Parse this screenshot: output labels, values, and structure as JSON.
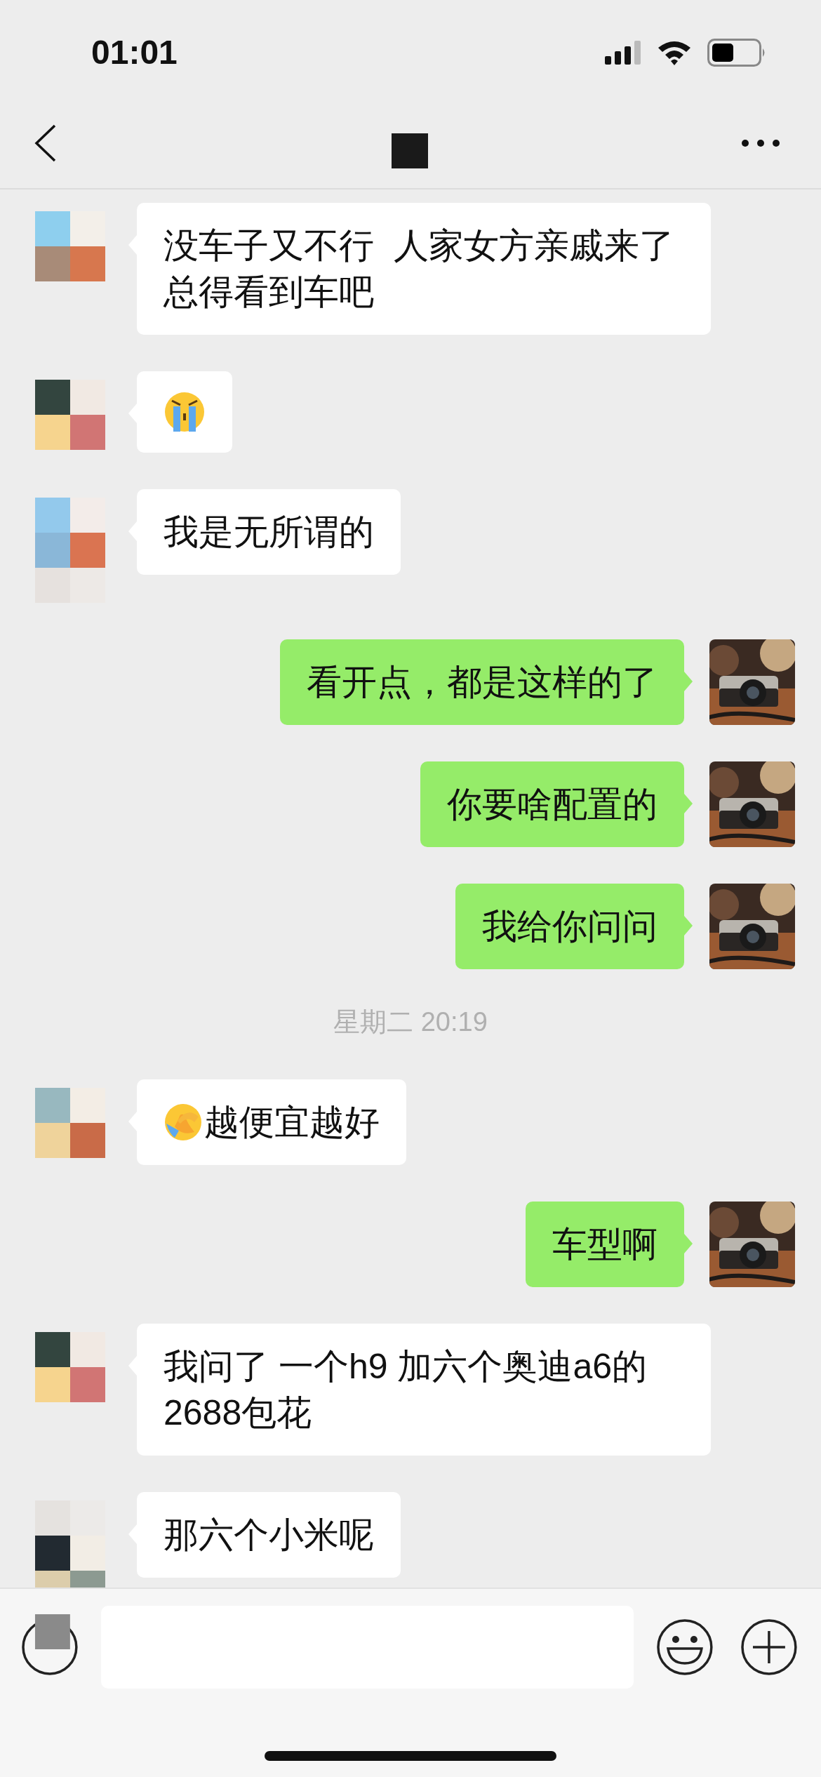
{
  "status_bar": {
    "time": "01:01"
  },
  "messages": [
    {
      "kind": "text",
      "outgoing": false,
      "text": "没车子又不行  人家女方亲戚来了总得看到车吧"
    },
    {
      "kind": "emoji",
      "outgoing": false
    },
    {
      "kind": "text",
      "outgoing": false,
      "text": "我是无所谓的"
    },
    {
      "kind": "text",
      "outgoing": true,
      "text": "看开点，都是这样的了"
    },
    {
      "kind": "text",
      "outgoing": true,
      "text": "你要啥配置的"
    },
    {
      "kind": "text",
      "outgoing": true,
      "text": "我给你问问"
    },
    {
      "kind": "time",
      "text": "星期二 20:19"
    },
    {
      "kind": "emoji-text",
      "outgoing": false,
      "text": "越便宜越好"
    },
    {
      "kind": "text",
      "outgoing": true,
      "text": "车型啊"
    },
    {
      "kind": "text",
      "outgoing": false,
      "text": "我问了 一个h9 加六个奥迪a6的 2688包花"
    },
    {
      "kind": "text",
      "outgoing": false,
      "text": "那六个小米呢"
    }
  ]
}
